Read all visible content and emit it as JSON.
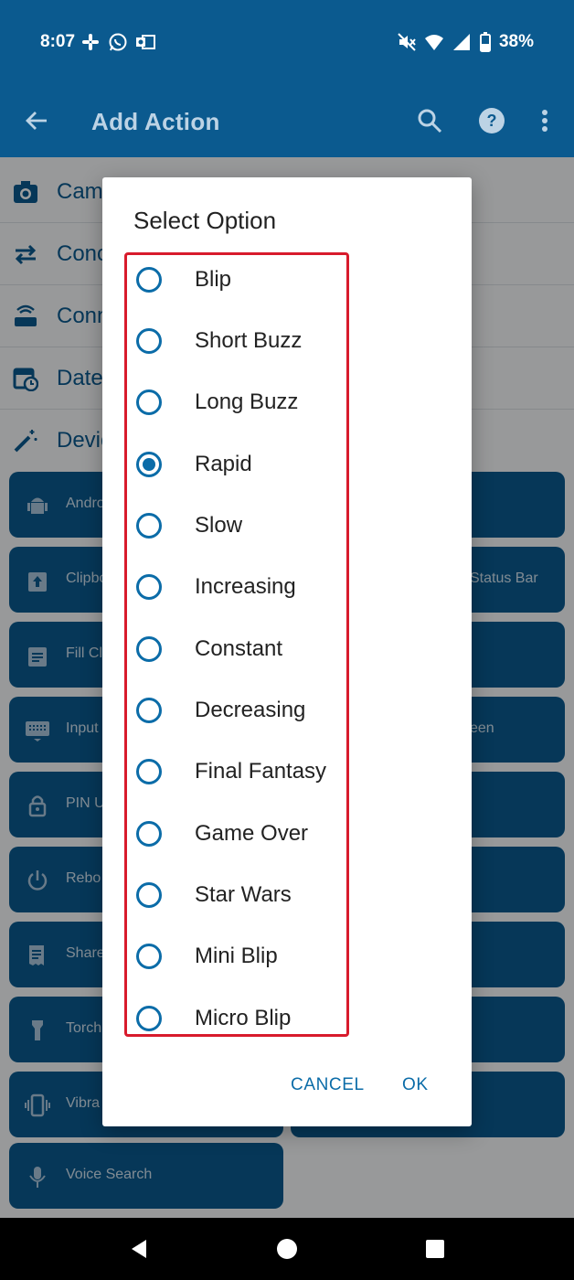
{
  "status": {
    "time": "8:07",
    "battery": "38%",
    "left_icons": [
      "slack-icon",
      "whatsapp-icon",
      "outlook-icon"
    ],
    "right_icons": [
      "mute-icon",
      "wifi-icon",
      "signal-icon",
      "battery-icon"
    ]
  },
  "app_bar": {
    "title": "Add Action",
    "icons": [
      "back-arrow-icon",
      "search-icon",
      "help-icon",
      "more-vert-icon"
    ]
  },
  "background": {
    "categories": [
      {
        "label": "Cam",
        "icon": "camera-icon"
      },
      {
        "label": "Conc",
        "icon": "repeat-icon"
      },
      {
        "label": "Conn",
        "icon": "router-icon"
      },
      {
        "label": "Date",
        "icon": "calendar-icon"
      },
      {
        "label": "Devic",
        "icon": "magic-wand-icon"
      }
    ],
    "tiles_left": [
      {
        "label": "Andro",
        "icon": "android-icon"
      },
      {
        "label": "Clipbo",
        "icon": "clipboard-up-icon"
      },
      {
        "label": "Fill Cl",
        "icon": "clipboard-list-icon"
      },
      {
        "label": "Input",
        "icon": "keyboard-icon"
      },
      {
        "label": "PIN U",
        "icon": "lock-icon"
      },
      {
        "label": "Rebo",
        "icon": "power-icon"
      },
      {
        "label": "Share",
        "icon": "receipt-icon"
      },
      {
        "label": "Torch",
        "icon": "flashlight-icon"
      },
      {
        "label": "Vibra",
        "icon": "vibrate-icon"
      },
      {
        "label": "Voice Search",
        "icon": "mic-icon"
      }
    ],
    "tiles_right_labels": [
      "Status Bar",
      "een"
    ]
  },
  "dialog": {
    "title": "Select Option",
    "options": [
      {
        "label": "Blip",
        "selected": false
      },
      {
        "label": "Short Buzz",
        "selected": false
      },
      {
        "label": "Long Buzz",
        "selected": false
      },
      {
        "label": "Rapid",
        "selected": true
      },
      {
        "label": "Slow",
        "selected": false
      },
      {
        "label": "Increasing",
        "selected": false
      },
      {
        "label": "Constant",
        "selected": false
      },
      {
        "label": "Decreasing",
        "selected": false
      },
      {
        "label": "Final Fantasy",
        "selected": false
      },
      {
        "label": "Game Over",
        "selected": false
      },
      {
        "label": "Star Wars",
        "selected": false
      },
      {
        "label": "Mini Blip",
        "selected": false
      },
      {
        "label": "Micro Blip",
        "selected": false
      }
    ],
    "cancel_label": "CANCEL",
    "ok_label": "OK"
  },
  "colors": {
    "primary": "#0b5a8f",
    "accent": "#0b6ca8",
    "highlight_box": "#d81b2c"
  },
  "nav": {
    "icons": [
      "back-triangle-icon",
      "home-circle-icon",
      "recents-square-icon"
    ]
  }
}
